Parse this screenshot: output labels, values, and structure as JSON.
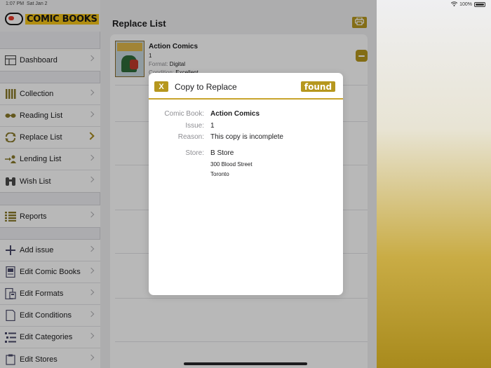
{
  "status": {
    "time": "1:07 PM",
    "date": "Sat Jan 2",
    "battery": "100%"
  },
  "sidebar": {
    "logo": "COMIC BOOKS",
    "groups": [
      [
        {
          "label": "Dashboard",
          "icon": "dashboard-icon"
        }
      ],
      [
        {
          "label": "Collection",
          "icon": "collection-icon"
        },
        {
          "label": "Reading List",
          "icon": "glasses-icon"
        },
        {
          "label": "Replace List",
          "icon": "replace-icon",
          "active": true
        },
        {
          "label": "Lending List",
          "icon": "lending-icon"
        },
        {
          "label": "Wish List",
          "icon": "binoculars-icon"
        }
      ],
      [
        {
          "label": "Reports",
          "icon": "reports-icon"
        }
      ],
      [
        {
          "label": "Add issue",
          "icon": "plus-icon"
        },
        {
          "label": "Edit Comic Books",
          "icon": "edit-comics-icon"
        },
        {
          "label": "Edit Formats",
          "icon": "edit-formats-icon"
        },
        {
          "label": "Edit Conditions",
          "icon": "edit-conditions-icon"
        },
        {
          "label": "Edit Categories",
          "icon": "edit-categories-icon"
        },
        {
          "label": "Edit Stores",
          "icon": "edit-stores-icon"
        }
      ]
    ]
  },
  "main": {
    "title": "Replace List",
    "item": {
      "name": "Action Comics",
      "issue": "1",
      "format_label": "Format:",
      "format": "Digital",
      "condition_label": "Condition:",
      "condition": "Excellent",
      "cover_title": "Action Comics"
    }
  },
  "modal": {
    "title": "Copy to Replace",
    "close_label": "X",
    "found_label": "found",
    "comic_book_label": "Comic Book:",
    "comic_book": "Action Comics",
    "issue_label": "Issue:",
    "issue": "1",
    "reason_label": "Reason:",
    "reason": "This copy is incomplete",
    "store_label": "Store:",
    "store": "B Store",
    "street": "300 Blood Street",
    "city": "Toronto"
  },
  "colors": {
    "accent": "#b6971e",
    "accent_line": "#c8a42c"
  }
}
